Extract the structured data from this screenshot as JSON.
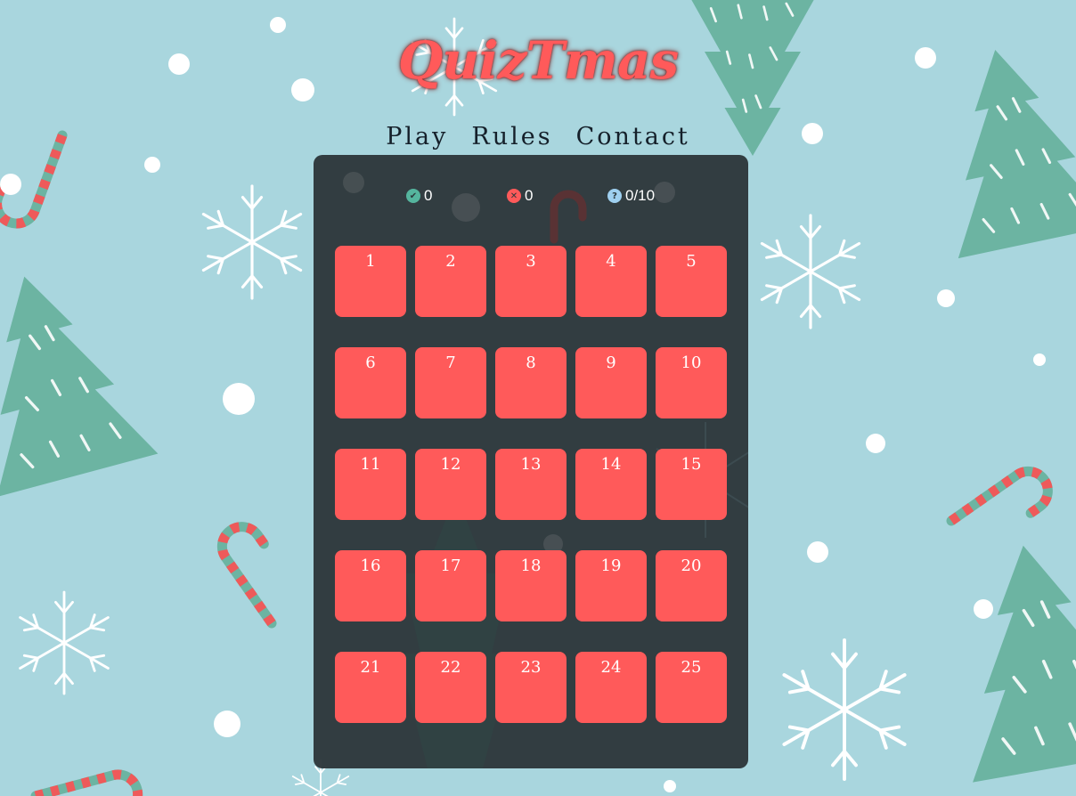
{
  "app": {
    "title": "QuizTmas"
  },
  "nav": [
    {
      "label": "Play"
    },
    {
      "label": "Rules"
    },
    {
      "label": "Contact"
    }
  ],
  "stats": {
    "correct": {
      "icon": "check-circle-icon",
      "color": "#55b59e",
      "value": "0"
    },
    "wrong": {
      "icon": "x-circle-icon",
      "color": "#ff5a5a",
      "value": "0"
    },
    "questions": {
      "icon": "question-circle-icon",
      "color": "#9fd0f0",
      "value": "0/10"
    }
  },
  "days": [
    "1",
    "2",
    "3",
    "4",
    "5",
    "6",
    "7",
    "8",
    "9",
    "10",
    "11",
    "12",
    "13",
    "14",
    "15",
    "16",
    "17",
    "18",
    "19",
    "20",
    "21",
    "22",
    "23",
    "24",
    "25"
  ],
  "colors": {
    "background": "#a9d6de",
    "panel": "#2e383c",
    "tile": "#ff5a5a",
    "tree": "#6cb4a2",
    "candy_red": "#ee5a5a",
    "candy_green": "#6cb4a2"
  }
}
